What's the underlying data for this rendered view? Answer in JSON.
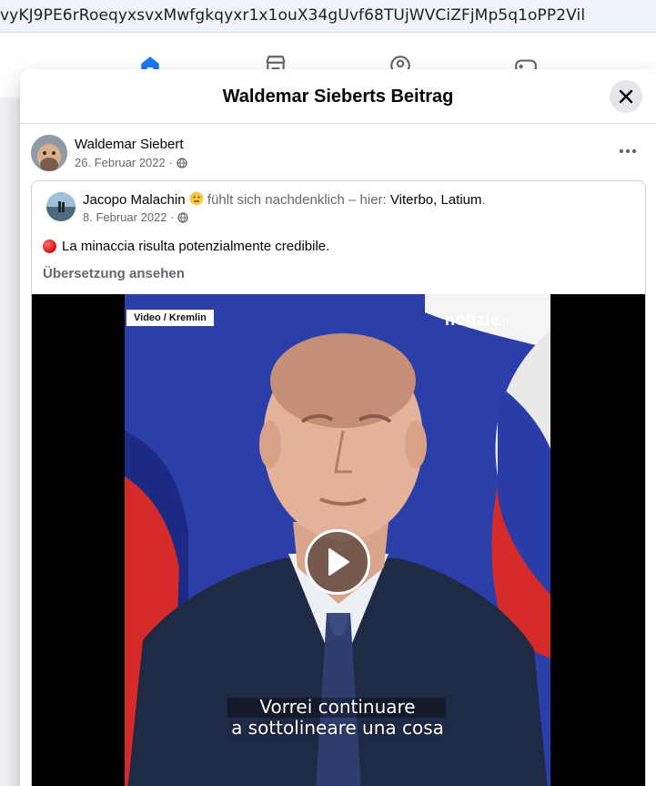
{
  "browser": {
    "url": "vyKJ9PE6rRoeqyxsvxMwfgkqyxr1x1ouX34gUvf68TUjWVCiZFjMp5q1oPP2Vil"
  },
  "nav": {
    "icons": [
      "home-icon",
      "marketplace-icon",
      "groups-icon",
      "gaming-icon"
    ],
    "active_color": "#1877f2"
  },
  "modal": {
    "title": "Waldemar Sieberts Beitrag",
    "close_icon": "close-icon"
  },
  "post": {
    "author": "Waldemar Siebert",
    "date": "26. Februar 2022 ·",
    "privacy_icon": "globe-icon",
    "more_icon": "more-icon"
  },
  "shared_post": {
    "author": "Jacopo Malachin",
    "feeling_text": "fühlt sich nachdenklich – hier:",
    "location": "Viterbo, Latium",
    "location_suffix": ".",
    "date": "8. Februar 2022 ·",
    "text": "La minaccia risulta potenzialmente credibile.",
    "translate_label": "Übersetzung ansehen"
  },
  "video": {
    "label": "Video / Kremlin",
    "brand_main": "notizie",
    "brand_suffix": ".it",
    "subtitle_line1": "Vorrei continuare",
    "subtitle_line2": "a sottolineare una cosa",
    "play_icon": "play-icon"
  },
  "colors": {
    "accent": "#1877f2",
    "secondary_text": "#65676b",
    "divider": "#dddfe2"
  }
}
